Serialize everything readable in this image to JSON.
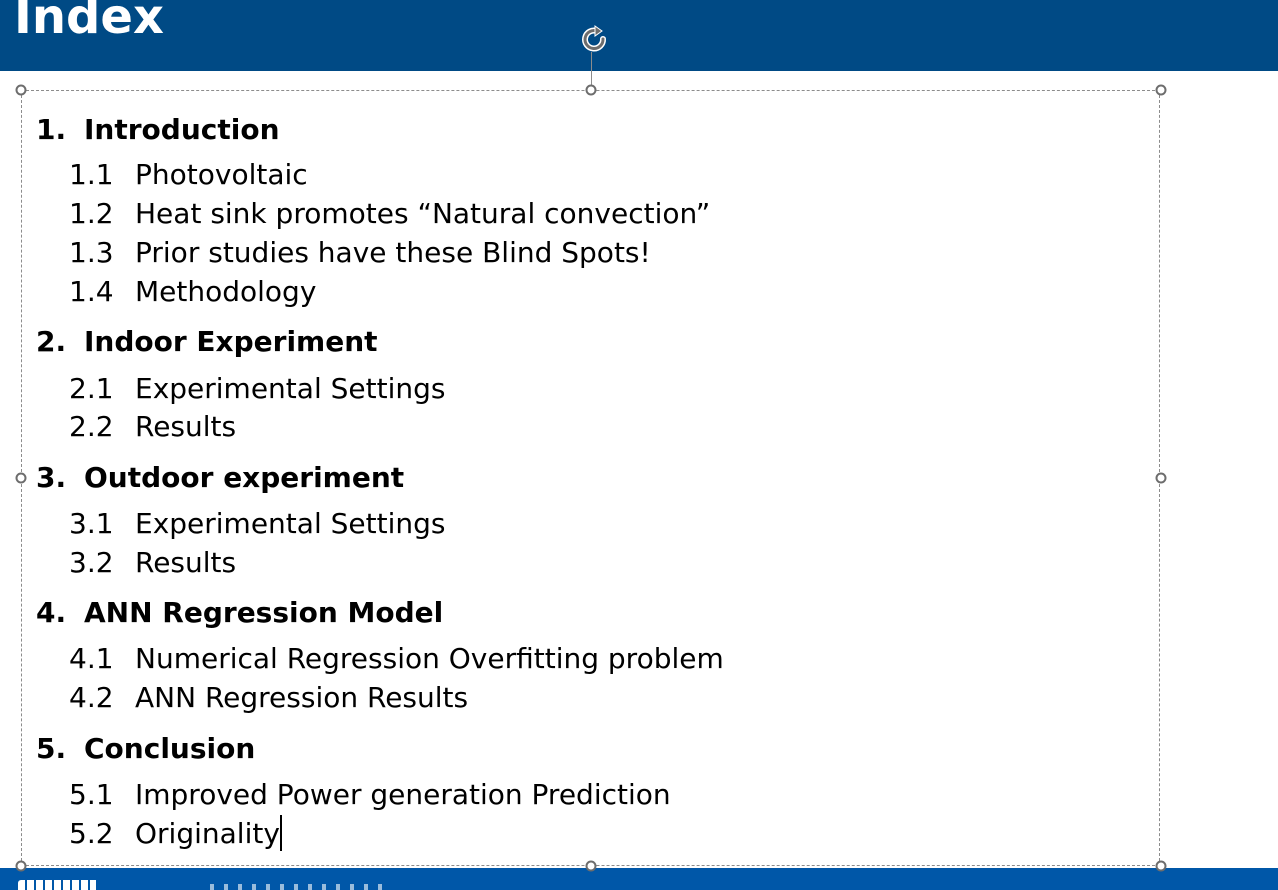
{
  "slide": {
    "title": "Index",
    "colors": {
      "title_bar": "#004a85",
      "bottom_bar": "#0057a8",
      "selection_border": "#8c8c8c",
      "handle": "#6d6d6d",
      "text": "#000000"
    },
    "icons": {
      "rotate": "rotate-icon"
    }
  },
  "outline": [
    {
      "num": "1.",
      "label": "Introduction",
      "items": [
        {
          "num": "1.1",
          "label": "Photovoltaic"
        },
        {
          "num": "1.2",
          "label": "Heat sink promotes “Natural convection”"
        },
        {
          "num": "1.3",
          "label": "Prior studies have these Blind Spots!"
        },
        {
          "num": "1.4",
          "label": "Methodology"
        }
      ]
    },
    {
      "num": "2.",
      "label": "Indoor Experiment",
      "items": [
        {
          "num": "2.1",
          "label": "Experimental Settings"
        },
        {
          "num": "2.2",
          "label": "Results"
        }
      ]
    },
    {
      "num": "3.",
      "label": "Outdoor experiment",
      "items": [
        {
          "num": "3.1",
          "label": "Experimental Settings"
        },
        {
          "num": "3.2",
          "label": "Results"
        }
      ]
    },
    {
      "num": "4.",
      "label": "ANN Regression Model",
      "items": [
        {
          "num": "4.1",
          "label": "Numerical Regression Overfitting problem"
        },
        {
          "num": "4.2",
          "label": "ANN Regression Results"
        }
      ]
    },
    {
      "num": "5.",
      "label": "Conclusion",
      "items": [
        {
          "num": "5.1",
          "label": "Improved Power generation Prediction"
        },
        {
          "num": "5.2",
          "label": "Originality"
        }
      ]
    }
  ]
}
